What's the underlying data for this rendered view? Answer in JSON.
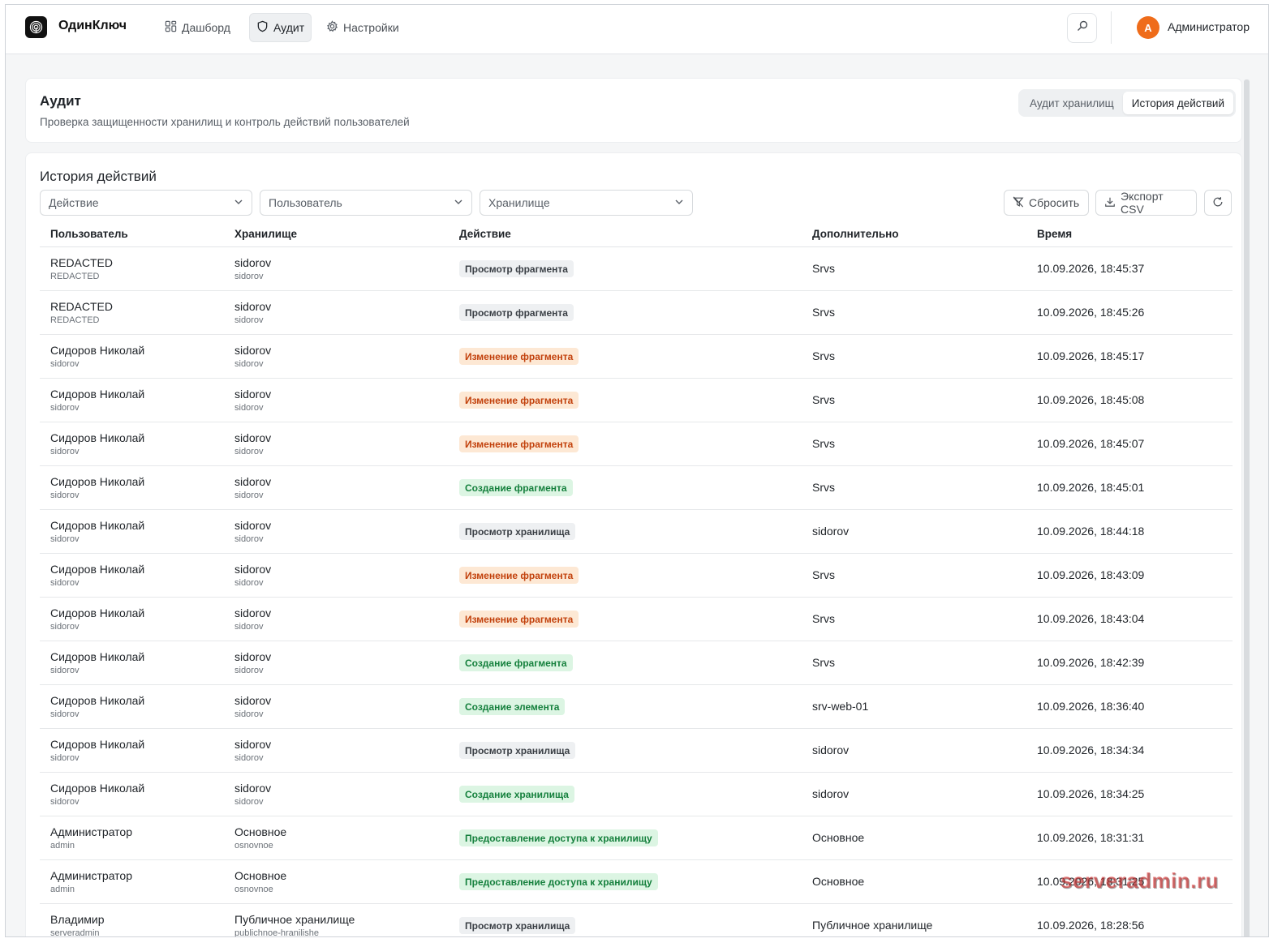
{
  "app": {
    "name": "ОдинКлюч"
  },
  "nav": [
    {
      "label": "Дашборд",
      "icon": "dashboard-icon"
    },
    {
      "label": "Аудит",
      "icon": "shield-icon",
      "active": true
    },
    {
      "label": "Настройки",
      "icon": "gear-icon"
    }
  ],
  "user": {
    "initial": "A",
    "name": "Администратор",
    "avatar_color": "#ef6c1a"
  },
  "header": {
    "title": "Аудит",
    "subtitle": "Проверка защищенности хранилищ и контроль действий пользователей",
    "tabs": [
      {
        "label": "Аудит хранилищ",
        "active": false
      },
      {
        "label": "История действий",
        "active": true
      }
    ]
  },
  "history": {
    "title": "История действий",
    "filters": {
      "action": "Действие",
      "user": "Пользователь",
      "vault": "Хранилище"
    },
    "buttons": {
      "reset": "Сбросить",
      "export": "Экспорт CSV"
    },
    "columns": {
      "user": "Пользователь",
      "vault": "Хранилище",
      "action": "Действие",
      "extra": "Дополнительно",
      "time": "Время"
    },
    "rows": [
      {
        "user": "REDACTED",
        "login": "REDACTED",
        "vault": "sidorov",
        "vault_id": "sidorov",
        "action": "Просмотр фрагмента",
        "kind": "view",
        "extra": "Srvs",
        "time": "10.09.2026, 18:45:37"
      },
      {
        "user": "REDACTED",
        "login": "REDACTED",
        "vault": "sidorov",
        "vault_id": "sidorov",
        "action": "Просмотр фрагмента",
        "kind": "view",
        "extra": "Srvs",
        "time": "10.09.2026, 18:45:26"
      },
      {
        "user": "Сидоров Николай",
        "login": "sidorov",
        "vault": "sidorov",
        "vault_id": "sidorov",
        "action": "Изменение фрагмента",
        "kind": "edit",
        "extra": "Srvs",
        "time": "10.09.2026, 18:45:17"
      },
      {
        "user": "Сидоров Николай",
        "login": "sidorov",
        "vault": "sidorov",
        "vault_id": "sidorov",
        "action": "Изменение фрагмента",
        "kind": "edit",
        "extra": "Srvs",
        "time": "10.09.2026, 18:45:08"
      },
      {
        "user": "Сидоров Николай",
        "login": "sidorov",
        "vault": "sidorov",
        "vault_id": "sidorov",
        "action": "Изменение фрагмента",
        "kind": "edit",
        "extra": "Srvs",
        "time": "10.09.2026, 18:45:07"
      },
      {
        "user": "Сидоров Николай",
        "login": "sidorov",
        "vault": "sidorov",
        "vault_id": "sidorov",
        "action": "Создание фрагмента",
        "kind": "create",
        "extra": "Srvs",
        "time": "10.09.2026, 18:45:01"
      },
      {
        "user": "Сидоров Николай",
        "login": "sidorov",
        "vault": "sidorov",
        "vault_id": "sidorov",
        "action": "Просмотр хранилища",
        "kind": "view",
        "extra": "sidorov",
        "time": "10.09.2026, 18:44:18"
      },
      {
        "user": "Сидоров Николай",
        "login": "sidorov",
        "vault": "sidorov",
        "vault_id": "sidorov",
        "action": "Изменение фрагмента",
        "kind": "edit",
        "extra": "Srvs",
        "time": "10.09.2026, 18:43:09"
      },
      {
        "user": "Сидоров Николай",
        "login": "sidorov",
        "vault": "sidorov",
        "vault_id": "sidorov",
        "action": "Изменение фрагмента",
        "kind": "edit",
        "extra": "Srvs",
        "time": "10.09.2026, 18:43:04"
      },
      {
        "user": "Сидоров Николай",
        "login": "sidorov",
        "vault": "sidorov",
        "vault_id": "sidorov",
        "action": "Создание фрагмента",
        "kind": "create",
        "extra": "Srvs",
        "time": "10.09.2026, 18:42:39"
      },
      {
        "user": "Сидоров Николай",
        "login": "sidorov",
        "vault": "sidorov",
        "vault_id": "sidorov",
        "action": "Создание элемента",
        "kind": "create",
        "extra": "srv-web-01",
        "time": "10.09.2026, 18:36:40"
      },
      {
        "user": "Сидоров Николай",
        "login": "sidorov",
        "vault": "sidorov",
        "vault_id": "sidorov",
        "action": "Просмотр хранилища",
        "kind": "view",
        "extra": "sidorov",
        "time": "10.09.2026, 18:34:34"
      },
      {
        "user": "Сидоров Николай",
        "login": "sidorov",
        "vault": "sidorov",
        "vault_id": "sidorov",
        "action": "Создание хранилища",
        "kind": "create",
        "extra": "sidorov",
        "time": "10.09.2026, 18:34:25"
      },
      {
        "user": "Администратор",
        "login": "admin",
        "vault": "Основное",
        "vault_id": "osnovnoe",
        "action": "Предоставление доступа к хранилищу",
        "kind": "create",
        "extra": "Основное",
        "time": "10.09.2026, 18:31:31"
      },
      {
        "user": "Администратор",
        "login": "admin",
        "vault": "Основное",
        "vault_id": "osnovnoe",
        "action": "Предоставление доступа к хранилищу",
        "kind": "create",
        "extra": "Основное",
        "time": "10.09.2026, 18:31:25"
      },
      {
        "user": "Владимир",
        "login": "serveradmin",
        "vault": "Публичное хранилище",
        "vault_id": "publichnoe-hranilishe",
        "action": "Просмотр хранилища",
        "kind": "view",
        "extra": "Публичное хранилище",
        "time": "10.09.2026, 18:28:56"
      }
    ]
  },
  "badge_colors": {
    "view": {
      "bg": "#eef0f2",
      "fg": "#3a3f45"
    },
    "edit": {
      "bg": "#fde8d4",
      "fg": "#c2410c"
    },
    "create": {
      "bg": "#dcf5e3",
      "fg": "#15803d"
    }
  },
  "watermark": "serveradmin.ru"
}
